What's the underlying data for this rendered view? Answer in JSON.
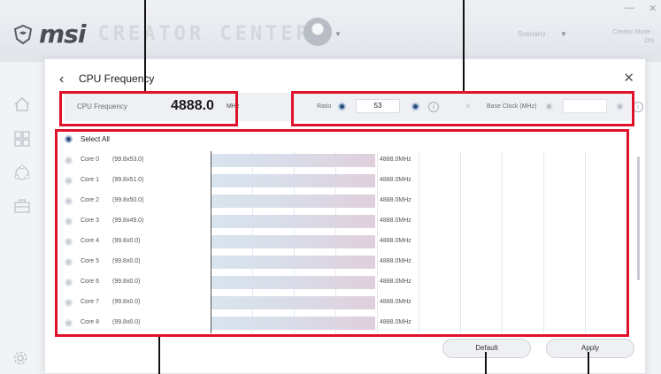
{
  "app": {
    "brand": "msi",
    "product": "CREATOR CENTER",
    "scenario_label": "Scenario :",
    "mode_label": "Creator Mode :",
    "mode_value": "ON"
  },
  "dialog": {
    "title": "CPU Frequency",
    "back_icon": "chevron-left-icon",
    "close_icon": "close-icon"
  },
  "frequency": {
    "label": "CPU Frequency",
    "value": "4888.0",
    "unit": "MHz",
    "ratio_label": "Ratio",
    "ratio_value": "53",
    "base_clock_label": "Base Clock (MHz)",
    "base_clock_value": ""
  },
  "cores": {
    "select_all_label": "Select All",
    "rows": [
      {
        "name": "Core 0",
        "ratio": "(99.8x53.0)",
        "value": "4888.0MHz"
      },
      {
        "name": "Core 1",
        "ratio": "(99.8x51.0)",
        "value": "4888.0MHz"
      },
      {
        "name": "Core 2",
        "ratio": "(99.8x50.0)",
        "value": "4888.0MHz"
      },
      {
        "name": "Core 3",
        "ratio": "(99.8x49.0)",
        "value": "4888.0MHz"
      },
      {
        "name": "Core 4",
        "ratio": "(99.8x0.0)",
        "value": "4888.0MHz"
      },
      {
        "name": "Core 5",
        "ratio": "(99.8x0.0)",
        "value": "4888.0MHz"
      },
      {
        "name": "Core 6",
        "ratio": "(99.8x0.0)",
        "value": "4888.0MHz"
      },
      {
        "name": "Core 7",
        "ratio": "(99.8x0.0)",
        "value": "4888.0MHz"
      },
      {
        "name": "Core 8",
        "ratio": "(99.8x0.0)",
        "value": "4888.0MHz"
      }
    ]
  },
  "buttons": {
    "default_label": "Default",
    "apply_label": "Apply"
  },
  "colors": {
    "highlight": "#e0122b",
    "knob_active": "#2f4f7a"
  }
}
